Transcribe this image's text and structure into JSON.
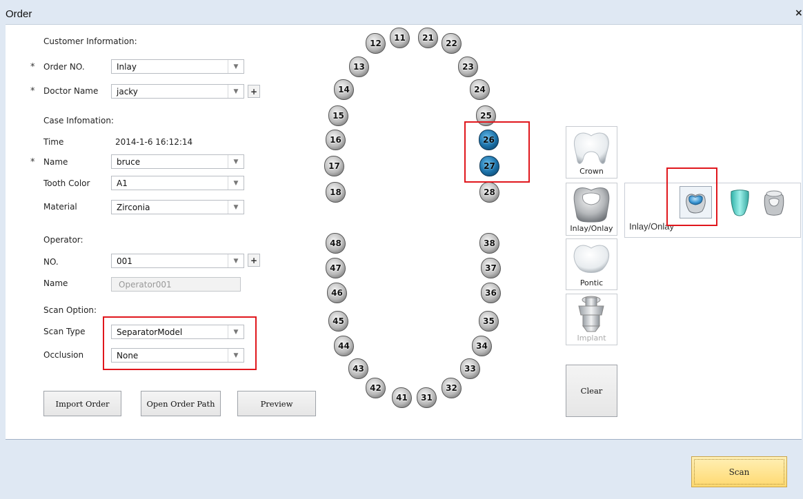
{
  "window": {
    "title": "Order",
    "close_glyph": "×"
  },
  "customer": {
    "heading": "Customer Information:",
    "order_no": {
      "label": "Order NO.",
      "value": "Inlay",
      "required": "*"
    },
    "doctor": {
      "label": "Doctor Name",
      "value": "jacky",
      "required": "*"
    }
  },
  "case": {
    "heading": "Case Infomation:",
    "time": {
      "label": "Time",
      "value": "2014-1-6 16:12:14"
    },
    "name": {
      "label": "Name",
      "value": "bruce",
      "required": "*"
    },
    "tooth_color": {
      "label": "Tooth Color",
      "value": "A1"
    },
    "material": {
      "label": "Material",
      "value": "Zirconia"
    }
  },
  "operator": {
    "heading": "Operator:",
    "no": {
      "label": "NO.",
      "value": "001"
    },
    "name": {
      "label": "Name",
      "placeholder": "Operator001"
    }
  },
  "scan_option": {
    "heading": "Scan Option:",
    "scan_type": {
      "label": "Scan Type",
      "value": "SeparatorModel"
    },
    "occlusion": {
      "label": "Occlusion",
      "value": "None"
    }
  },
  "buttons": {
    "import_order": "Import Order",
    "open_order_path": "Open Order Path",
    "preview": "Preview",
    "clear": "Clear",
    "scan": "Scan",
    "plus": "+",
    "dropdown": "▼"
  },
  "teeth": {
    "upper": [
      "11",
      "12",
      "13",
      "14",
      "15",
      "16",
      "17",
      "18",
      "21",
      "22",
      "23",
      "24",
      "25",
      "26",
      "27",
      "28"
    ],
    "lower": [
      "31",
      "32",
      "33",
      "34",
      "35",
      "36",
      "37",
      "38",
      "41",
      "42",
      "43",
      "44",
      "45",
      "46",
      "47",
      "48"
    ],
    "selected": [
      "26",
      "27"
    ]
  },
  "tooth_types": {
    "crown": "Crown",
    "inlay_onlay": "Inlay/Onlay",
    "pontic": "Pontic",
    "implant": "Implant"
  },
  "sub_panel": {
    "label": "Inlay/Onlay",
    "options": [
      "inlay-icon",
      "veneer-icon",
      "onlay-icon"
    ]
  },
  "colors": {
    "selection_box": "#e0161c",
    "selected_tooth": "#1a6fa6",
    "scan_button": "#ffd970"
  }
}
